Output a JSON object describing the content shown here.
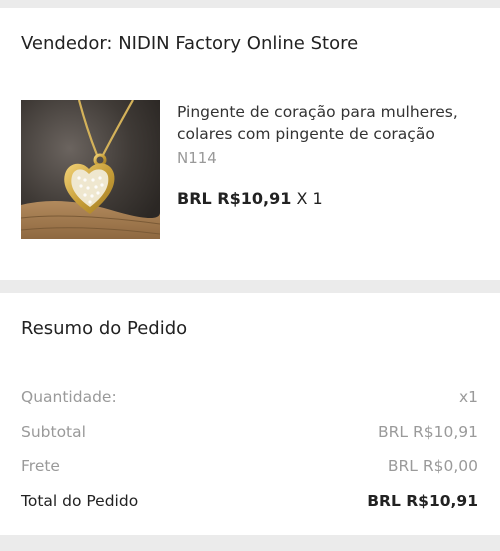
{
  "seller": {
    "label": "Vendedor: NIDIN Factory Online Store"
  },
  "product": {
    "title": "Pingente de coração para mulheres, colares com pingente de coração",
    "sku": "N114",
    "price": "BRL R$10,91",
    "quantity": "X 1",
    "image_icon": "heart-pendant-photo"
  },
  "summary": {
    "title": "Resumo do Pedido",
    "rows": [
      {
        "label": "Quantidade:",
        "value": "x1"
      },
      {
        "label": "Subtotal",
        "value": "BRL R$10,91"
      },
      {
        "label": "Frete",
        "value": "BRL R$0,00"
      },
      {
        "label": "Total do Pedido",
        "value": "BRL R$10,91"
      }
    ]
  },
  "colors": {
    "background": "#ebebeb",
    "card": "#ffffff",
    "muted_text": "#9a9a9a",
    "text": "#222222"
  }
}
